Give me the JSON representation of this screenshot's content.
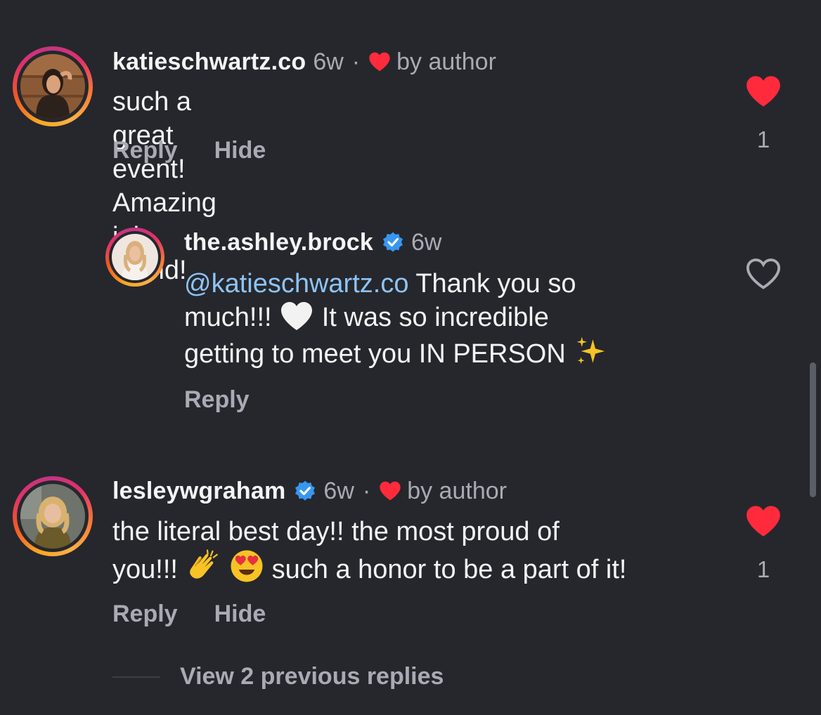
{
  "comments": [
    {
      "username": "katieschwartz.co",
      "time": "6w",
      "separator": "·",
      "author_label": "by author",
      "text": "such a great event! Amazing job friend!",
      "reply_label": "Reply",
      "hide_label": "Hide",
      "liked": true,
      "like_count": "1"
    },
    {
      "username": "the.ashley.brock",
      "verified": true,
      "time": "6w",
      "mention": "@katieschwartz.co",
      "text_line1": " Thank you so",
      "text_line2a": "much!!! ",
      "text_line2b": " It was so incredible",
      "text_line3": "getting to meet you IN PERSON ",
      "reply_label": "Reply",
      "liked": false
    },
    {
      "username": "lesleywgraham",
      "verified": true,
      "time": "6w",
      "separator": "·",
      "author_label": "by author",
      "text_line1": "the literal best day!! the most proud of",
      "text_line2a": "you!!! ",
      "text_line2b": " such a honor to be a part of it!",
      "reply_label": "Reply",
      "hide_label": "Hide",
      "liked": true,
      "like_count": "1"
    }
  ],
  "view_replies_label": "View 2 previous replies",
  "icons": {
    "heart_filled": "heart-filled-icon",
    "heart_outline": "heart-outline-icon",
    "verified": "verified-badge-icon",
    "white_heart_emoji": "white-heart-emoji",
    "sparkles_emoji": "sparkles-emoji",
    "clap_emoji": "clapping-hands-emoji",
    "heart_eyes_emoji": "heart-eyes-emoji"
  },
  "colors": {
    "background": "#25272c",
    "like_red": "#ff2b3d",
    "verified_blue": "#3797f0",
    "mention_blue": "#8fc3f5",
    "muted_text": "#a8abb3"
  }
}
